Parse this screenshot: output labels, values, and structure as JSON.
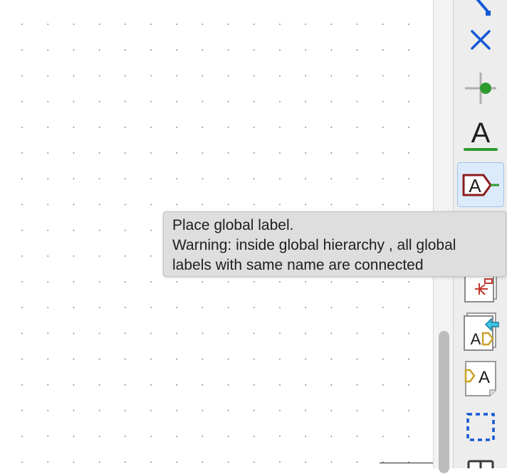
{
  "tooltip": {
    "line1": "Place global label.",
    "line2": "Warning: inside global hierarchy , all global",
    "line3": "labels with same name are connected"
  },
  "toolbar": {
    "tools": [
      {
        "name": "wire-tool",
        "icon": "wire-icon"
      },
      {
        "name": "no-connect-tool",
        "icon": "no-connect-icon"
      },
      {
        "name": "junction-tool",
        "icon": "junction-icon"
      },
      {
        "name": "net-label-tool",
        "icon": "net-label-icon",
        "glyph": "A"
      },
      {
        "name": "global-label-tool",
        "icon": "global-label-icon",
        "glyph": "A",
        "active": true
      },
      {
        "name": "hierarchical-label-tool",
        "icon": "hierarchical-label-icon"
      },
      {
        "name": "hierarchical-sheet-tool",
        "icon": "hierarchical-sheet-icon"
      },
      {
        "name": "import-sheet-pin-tool",
        "icon": "import-sheet-pin-icon",
        "glyph": "A"
      },
      {
        "name": "sheet-pin-tool",
        "icon": "sheet-pin-icon",
        "glyph": "A"
      },
      {
        "name": "rectangle-tool",
        "icon": "dashed-rectangle-icon"
      }
    ]
  },
  "colors": {
    "accent_blue": "#1558d6",
    "wire_green": "#2e9a2e",
    "label_red": "#8b1c1c",
    "pin_yellow": "#c9a227",
    "tooltip_bg": "#dedede"
  }
}
